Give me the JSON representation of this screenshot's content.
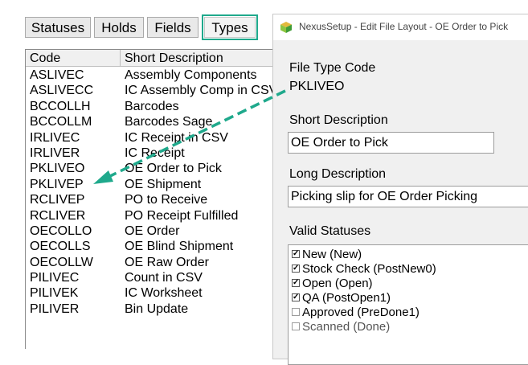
{
  "tabs": [
    {
      "label": "Statuses",
      "active": false
    },
    {
      "label": "Holds",
      "active": false
    },
    {
      "label": "Fields",
      "active": false
    },
    {
      "label": "Types",
      "active": true
    }
  ],
  "table": {
    "columns": [
      "Code",
      "Short Description"
    ],
    "rows": [
      {
        "code": "ASLIVEC",
        "desc": "Assembly Components"
      },
      {
        "code": "ASLIVECC",
        "desc": "IC Assembly Comp in CSV"
      },
      {
        "code": "BCCOLLH",
        "desc": "Barcodes"
      },
      {
        "code": "BCCOLLM",
        "desc": "Barcodes Sage"
      },
      {
        "code": "IRLIVEC",
        "desc": "IC Receipt in CSV"
      },
      {
        "code": "IRLIVER",
        "desc": "IC Receipt"
      },
      {
        "code": "PKLIVEO",
        "desc": "OE Order to Pick"
      },
      {
        "code": "PKLIVEP",
        "desc": "OE Shipment"
      },
      {
        "code": "RCLIVEP",
        "desc": "PO to Receive"
      },
      {
        "code": "RCLIVER",
        "desc": "PO Receipt Fulfilled"
      },
      {
        "code": "OECOLLO",
        "desc": "OE Order"
      },
      {
        "code": "OECOLLS",
        "desc": "OE Blind Shipment"
      },
      {
        "code": "OECOLLW",
        "desc": "OE Raw Order"
      },
      {
        "code": "PILIVEC",
        "desc": "Count in CSV"
      },
      {
        "code": "PILIVEK",
        "desc": "IC Worksheet"
      },
      {
        "code": "PILIVER",
        "desc": "Bin Update"
      }
    ]
  },
  "dialog": {
    "title": "NexusSetup - Edit File Layout - OE Order to Pick",
    "file_type_code_label": "File Type Code",
    "file_type_code_value": "PKLIVEO",
    "short_description_label": "Short Description",
    "short_description_value": "OE Order to Pick",
    "long_description_label": "Long Description",
    "long_description_value": "Picking slip for OE Order Picking",
    "valid_statuses_label": "Valid Statuses",
    "statuses": [
      {
        "label": "New (New)",
        "checked": true
      },
      {
        "label": "Stock Check (PostNew0)",
        "checked": true
      },
      {
        "label": "Open (Open)",
        "checked": true
      },
      {
        "label": "QA (PostOpen1)",
        "checked": true
      },
      {
        "label": "Approved (PreDone1)",
        "checked": false
      },
      {
        "label": "Scanned (Done)",
        "checked": false
      }
    ]
  },
  "colors": {
    "accent": "#1fa98c",
    "arrow": "#1fa98c"
  },
  "icons": {
    "app_icon": "nexus-cube-icon",
    "checked": "checkbox-checked-icon",
    "unchecked": "checkbox-unchecked-icon"
  }
}
